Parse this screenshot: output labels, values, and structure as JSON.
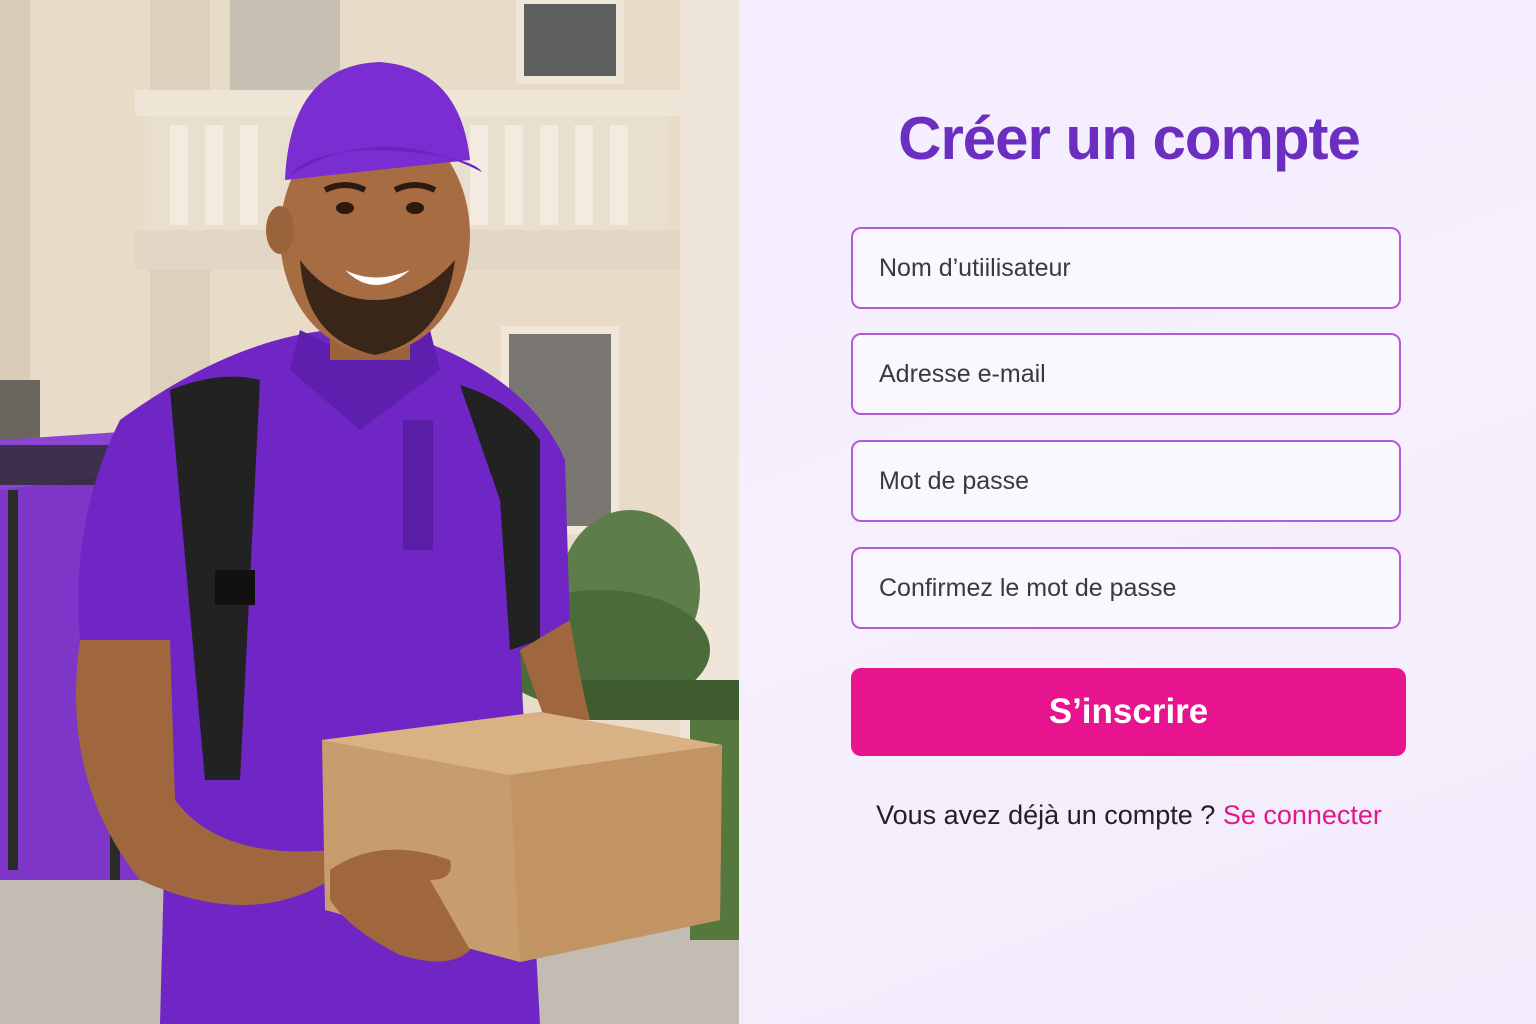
{
  "signup_form": {
    "title": "Créer un compte",
    "fields": {
      "username_placeholder": "Nom d’utiilisateur",
      "email_placeholder": "Adresse e-mail",
      "password_placeholder": "Mot de passe",
      "confirm_password_placeholder": "Confirmez le mot de passe"
    },
    "submit_label": "S’inscrire",
    "login_prompt": "Vous avez déjà un compte ?",
    "login_link_label": "Se connecter"
  },
  "colors": {
    "accent_purple": "#6b2ec0",
    "field_border": "#b55ad6",
    "button_pink": "#e8138e",
    "link_pink": "#dc1a88",
    "form_background": "#f4eefe"
  }
}
